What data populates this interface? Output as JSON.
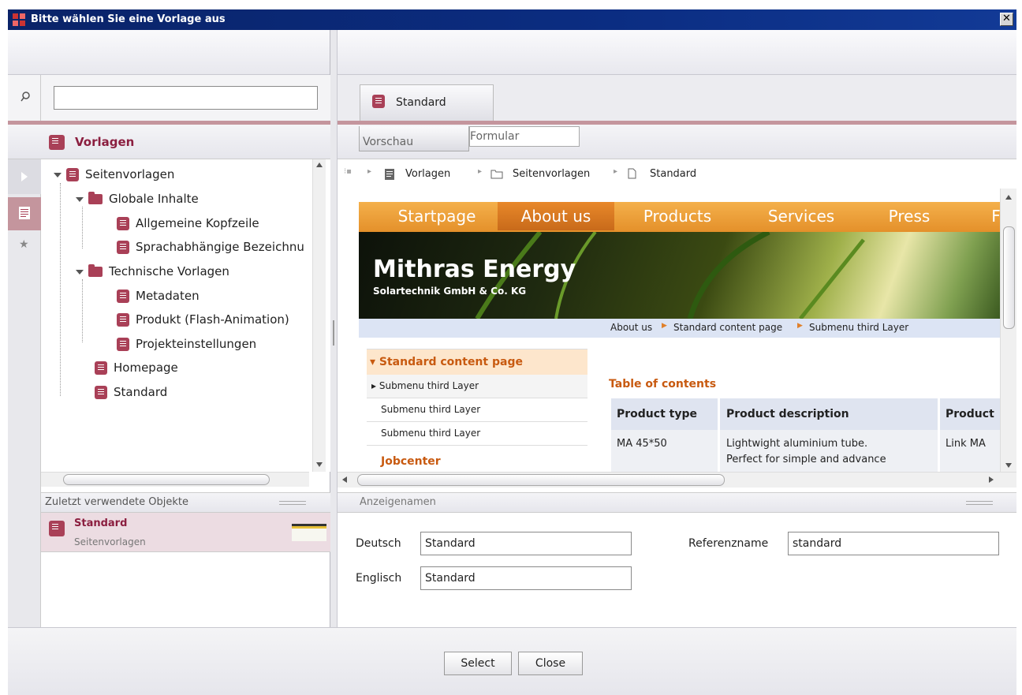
{
  "window": {
    "title": "Bitte wählen Sie eine Vorlage aus",
    "close": "✕"
  },
  "search": {
    "placeholder": "",
    "value": ""
  },
  "left": {
    "header": "Vorlagen",
    "tree": [
      {
        "label": "Seitenvorlagen",
        "type": "doc",
        "expanded": true
      },
      {
        "label": "Globale Inhalte",
        "type": "folder",
        "expanded": true
      },
      {
        "label": "Allgemeine Kopfzeile",
        "type": "doc"
      },
      {
        "label": "Sprachabhängige Bezeichnu",
        "type": "doc"
      },
      {
        "label": "Technische Vorlagen",
        "type": "folder",
        "expanded": true
      },
      {
        "label": "Metadaten",
        "type": "doc"
      },
      {
        "label": "Produkt (Flash-Animation)",
        "type": "doc"
      },
      {
        "label": "Projekteinstellungen",
        "type": "doc"
      },
      {
        "label": "Homepage",
        "type": "doc"
      },
      {
        "label": "Standard",
        "type": "doc"
      }
    ],
    "recent_header": "Zuletzt verwendete Objekte",
    "recent": [
      {
        "title": "Standard",
        "subtitle": "Seitenvorlagen"
      }
    ]
  },
  "right": {
    "tab": "Standard",
    "subtabs": {
      "preview": "Vorschau",
      "form": "Formular"
    },
    "breadcrumb": [
      "Vorlagen",
      "Seitenvorlagen",
      "Standard"
    ],
    "preview": {
      "nav": [
        "Startpage",
        "About us",
        "Products",
        "Services",
        "Press",
        "Fi"
      ],
      "brand": "Mithras Energy",
      "brand_sub": "Solartechnik GmbH & Co. KG",
      "crumbs": [
        "About us",
        "Standard content page",
        "Submenu third Layer"
      ],
      "menu": [
        "Standard content page",
        "Submenu third Layer",
        "Submenu third Layer",
        "Submenu third Layer",
        "Jobcenter"
      ],
      "toc": "Table of contents",
      "table_headers": [
        "Product type",
        "Product description",
        "Product"
      ],
      "row": [
        "MA 45*50",
        "Lightwight aluminium tube.",
        "Perfect for simple and advance",
        "Link MA"
      ]
    },
    "names_header": "Anzeigenamen",
    "fields": {
      "deutsch_label": "Deutsch",
      "deutsch": "Standard",
      "englisch_label": "Englisch",
      "englisch": "Standard",
      "ref_label": "Referenzname",
      "ref": "standard"
    }
  },
  "buttons": {
    "select": "Select",
    "close": "Close"
  },
  "colors": {
    "accent": "#a94057",
    "titlebar": "#0b2d82",
    "nav_orange": "#e8992e"
  }
}
